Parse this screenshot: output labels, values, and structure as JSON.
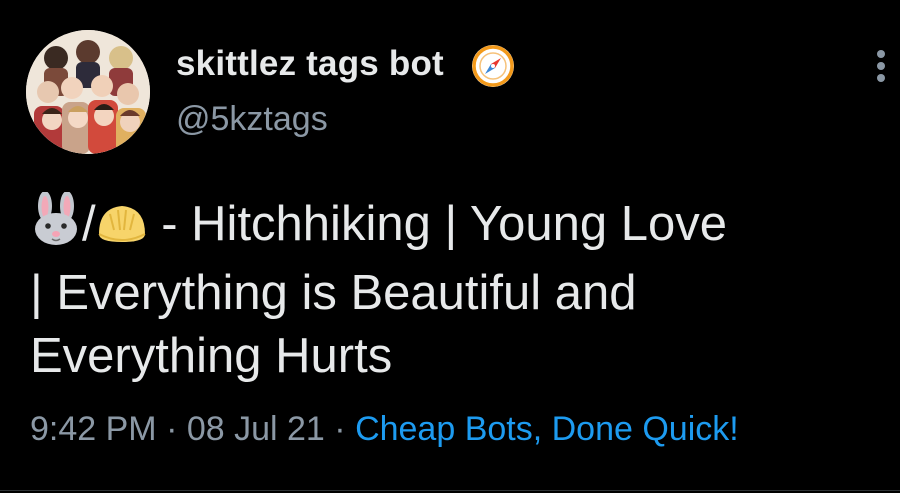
{
  "author": {
    "display_name": "skittlez tags bot",
    "handle": "@5kztags",
    "badge_icon": "compass-icon",
    "avatar_icon": "group-photo-avatar"
  },
  "tweet": {
    "emoji_1": "rabbit-face-icon",
    "separator": "/",
    "emoji_2": "dumpling-icon",
    "text_line_1": " - Hitchhiking | Young Love",
    "text_line_2": "| Everything is Beautiful and",
    "text_line_3": "Everything Hurts"
  },
  "meta": {
    "time": "9:42 PM",
    "dot_1": " · ",
    "date": "08 Jul 21",
    "dot_2": " · ",
    "source": "Cheap Bots, Done Quick!"
  },
  "colors": {
    "background": "#000000",
    "primary_text": "#e7e9ea",
    "secondary_text": "#8b98a5",
    "link": "#1d9bf0",
    "badge_orange": "#f39a1b"
  },
  "menu": {
    "icon": "more-options-icon"
  }
}
